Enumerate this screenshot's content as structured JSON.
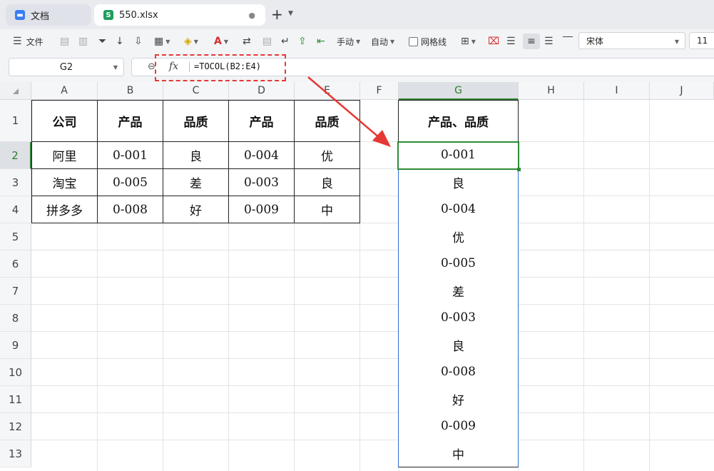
{
  "tabs": [
    {
      "label": "文档",
      "icon": "docs-icon"
    },
    {
      "label": "550.xlsx",
      "icon": "spreadsheet-icon",
      "icon_letter": "S"
    }
  ],
  "toolbar": {
    "file_label": "文件",
    "manual_label": "手动",
    "auto_label": "自动",
    "gridlines_label": "网格线",
    "font_name": "宋体",
    "font_size": "11"
  },
  "formula_bar": {
    "name_box": "G2",
    "fx_label": "fx",
    "formula": "=TOCOL(B2:E4)"
  },
  "columns": [
    "A",
    "B",
    "C",
    "D",
    "E",
    "F",
    "G",
    "H",
    "I",
    "J"
  ],
  "rows": [
    "1",
    "2",
    "3",
    "4",
    "5",
    "6",
    "7",
    "8",
    "9",
    "10",
    "11",
    "12",
    "13"
  ],
  "source_table": {
    "headers": [
      "公司",
      "产品",
      "品质",
      "产品",
      "品质"
    ],
    "rows": [
      [
        "阿里",
        "0-001",
        "良",
        "0-004",
        "优"
      ],
      [
        "淘宝",
        "0-005",
        "差",
        "0-003",
        "良"
      ],
      [
        "拼多多",
        "0-008",
        "好",
        "0-009",
        "中"
      ]
    ]
  },
  "result": {
    "header": "产品、品质",
    "values": [
      "0-001",
      "良",
      "0-004",
      "优",
      "0-005",
      "差",
      "0-003",
      "良",
      "0-008",
      "好",
      "0-009",
      "中"
    ]
  },
  "colors": {
    "selection": "#2e8b34",
    "annotation_red": "#e53935",
    "result_border_blue": "#2f6fd6"
  }
}
